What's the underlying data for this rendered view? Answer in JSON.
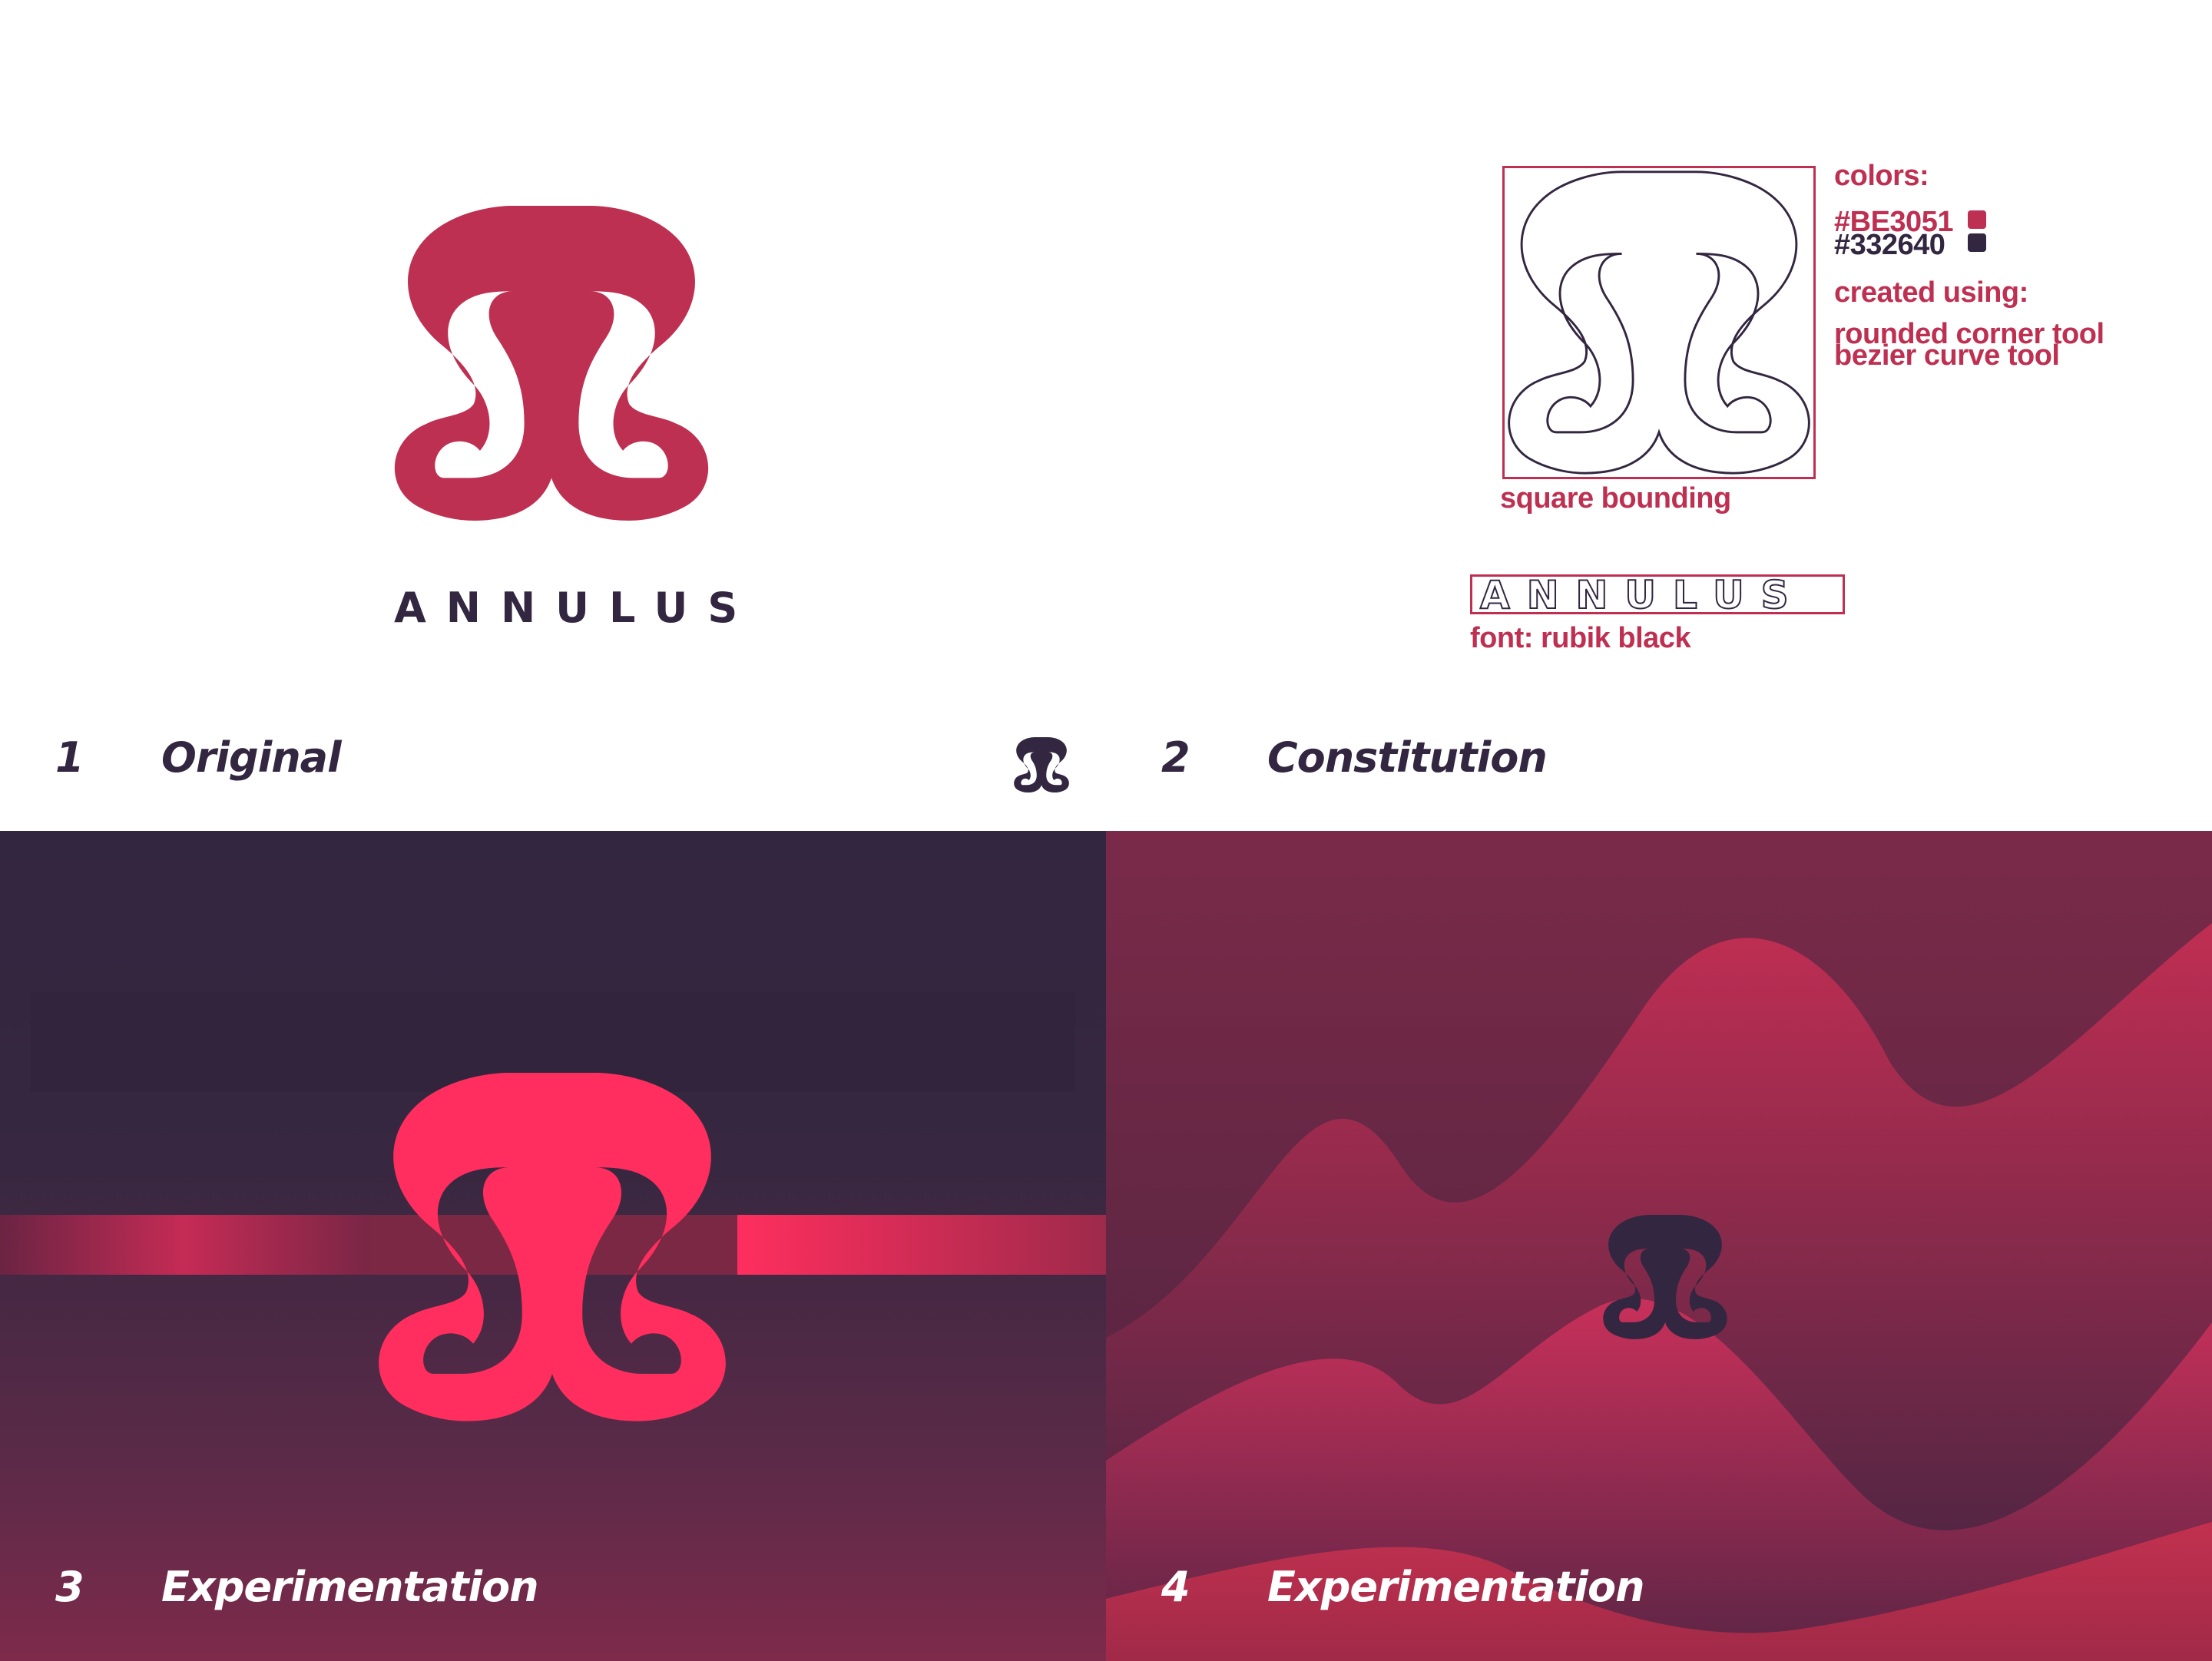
{
  "colors": {
    "brand_red": "#BE3051",
    "brand_dark": "#332640",
    "bright_pink": "#FF2E5E",
    "white": "#FFFFFF"
  },
  "section1": {
    "brand_name": "ANNULUS",
    "number": "1",
    "title": "Original"
  },
  "section2": {
    "number": "2",
    "title": "Constitution",
    "colors_heading": "colors:",
    "color_1_hex": "#BE3051",
    "color_2_hex": "#332640",
    "created_heading": "created using:",
    "tool_1": "rounded corner tool",
    "tool_2": "bezier curve tool",
    "bounding_label": "square bounding",
    "outline_word": "ANNULUS",
    "font_label": "font: rubik black"
  },
  "section3": {
    "number": "3",
    "title": "Experimentation"
  },
  "section4": {
    "number": "4",
    "title": "Experimentation"
  },
  "icons": {
    "logo": "annulus-logo-icon",
    "divider_logo": "annulus-small-logo-icon"
  }
}
